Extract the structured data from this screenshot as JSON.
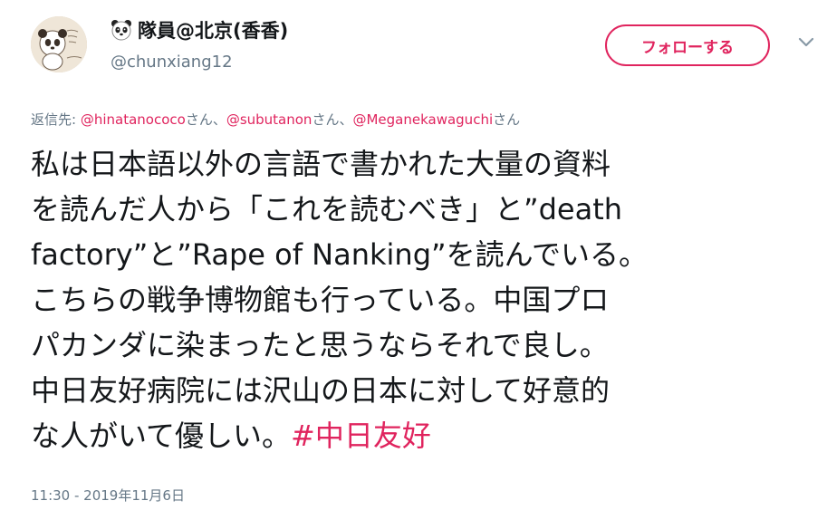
{
  "user": {
    "display_name": "隊員@北京(香香)",
    "handle": "@chunxiang12",
    "avatar_icon": "panda-avatar-icon",
    "name_icon": "panda-face-icon"
  },
  "follow_button": {
    "label": "フォローする"
  },
  "more_menu_icon": "chevron-down-icon",
  "reply": {
    "prefix": "返信先: ",
    "mentions": [
      {
        "handle": "@hinatanococo",
        "suffix": "さん、"
      },
      {
        "handle": "@subutanon",
        "suffix": "さん、"
      },
      {
        "handle": "@Meganekawaguchi",
        "suffix": "さん"
      }
    ]
  },
  "tweet": {
    "lines": [
      "私は日本語以外の言語で書かれた大量の資料",
      "を読んだ人から「これを読むべき」と”death",
      "factory”と”Rape of Nanking”を読んでいる。",
      "こちらの戦争博物館も行っている。中国プロ",
      "パカンダに染まったと思うならそれで良し。",
      "中日友好病院には沢山の日本に対して好意的"
    ],
    "last_line_text": "な人がいて優しい。",
    "hashtag": "#中日友好"
  },
  "timestamp": "11:30 - 2019年11月6日",
  "colors": {
    "accent": "#e0245e",
    "secondary_text": "#657786",
    "primary_text": "#14171a"
  }
}
